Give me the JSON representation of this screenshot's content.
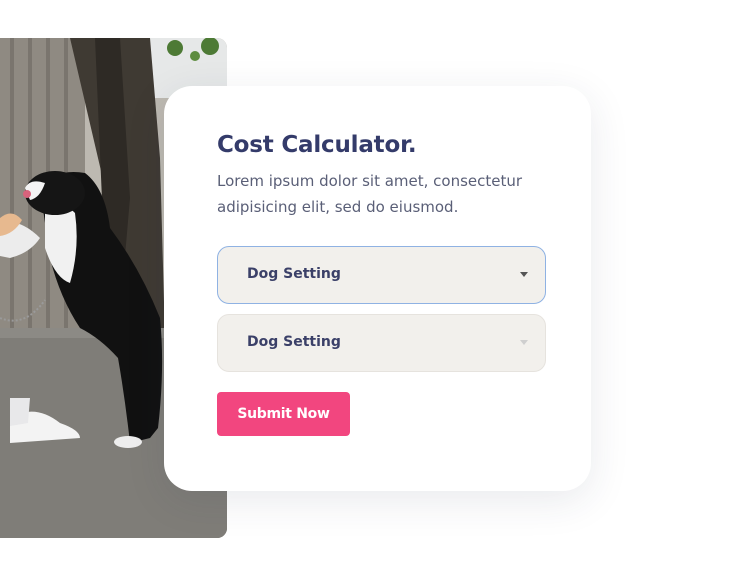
{
  "calculator": {
    "title": "Cost Calculator.",
    "description": "Lorem ipsum dolor sit amet, consectetur adipisicing elit, sed do eiusmod.",
    "selects": [
      {
        "label": "Dog Setting"
      },
      {
        "label": "Dog Setting"
      }
    ],
    "submit_label": "Submit Now"
  },
  "colors": {
    "title": "#343b6a",
    "accent_button": "#f2467f",
    "select_background": "#f2f0ec",
    "select_focus_border": "#8fb2e3"
  },
  "icons": {
    "select_caret": "caret-down-icon"
  }
}
